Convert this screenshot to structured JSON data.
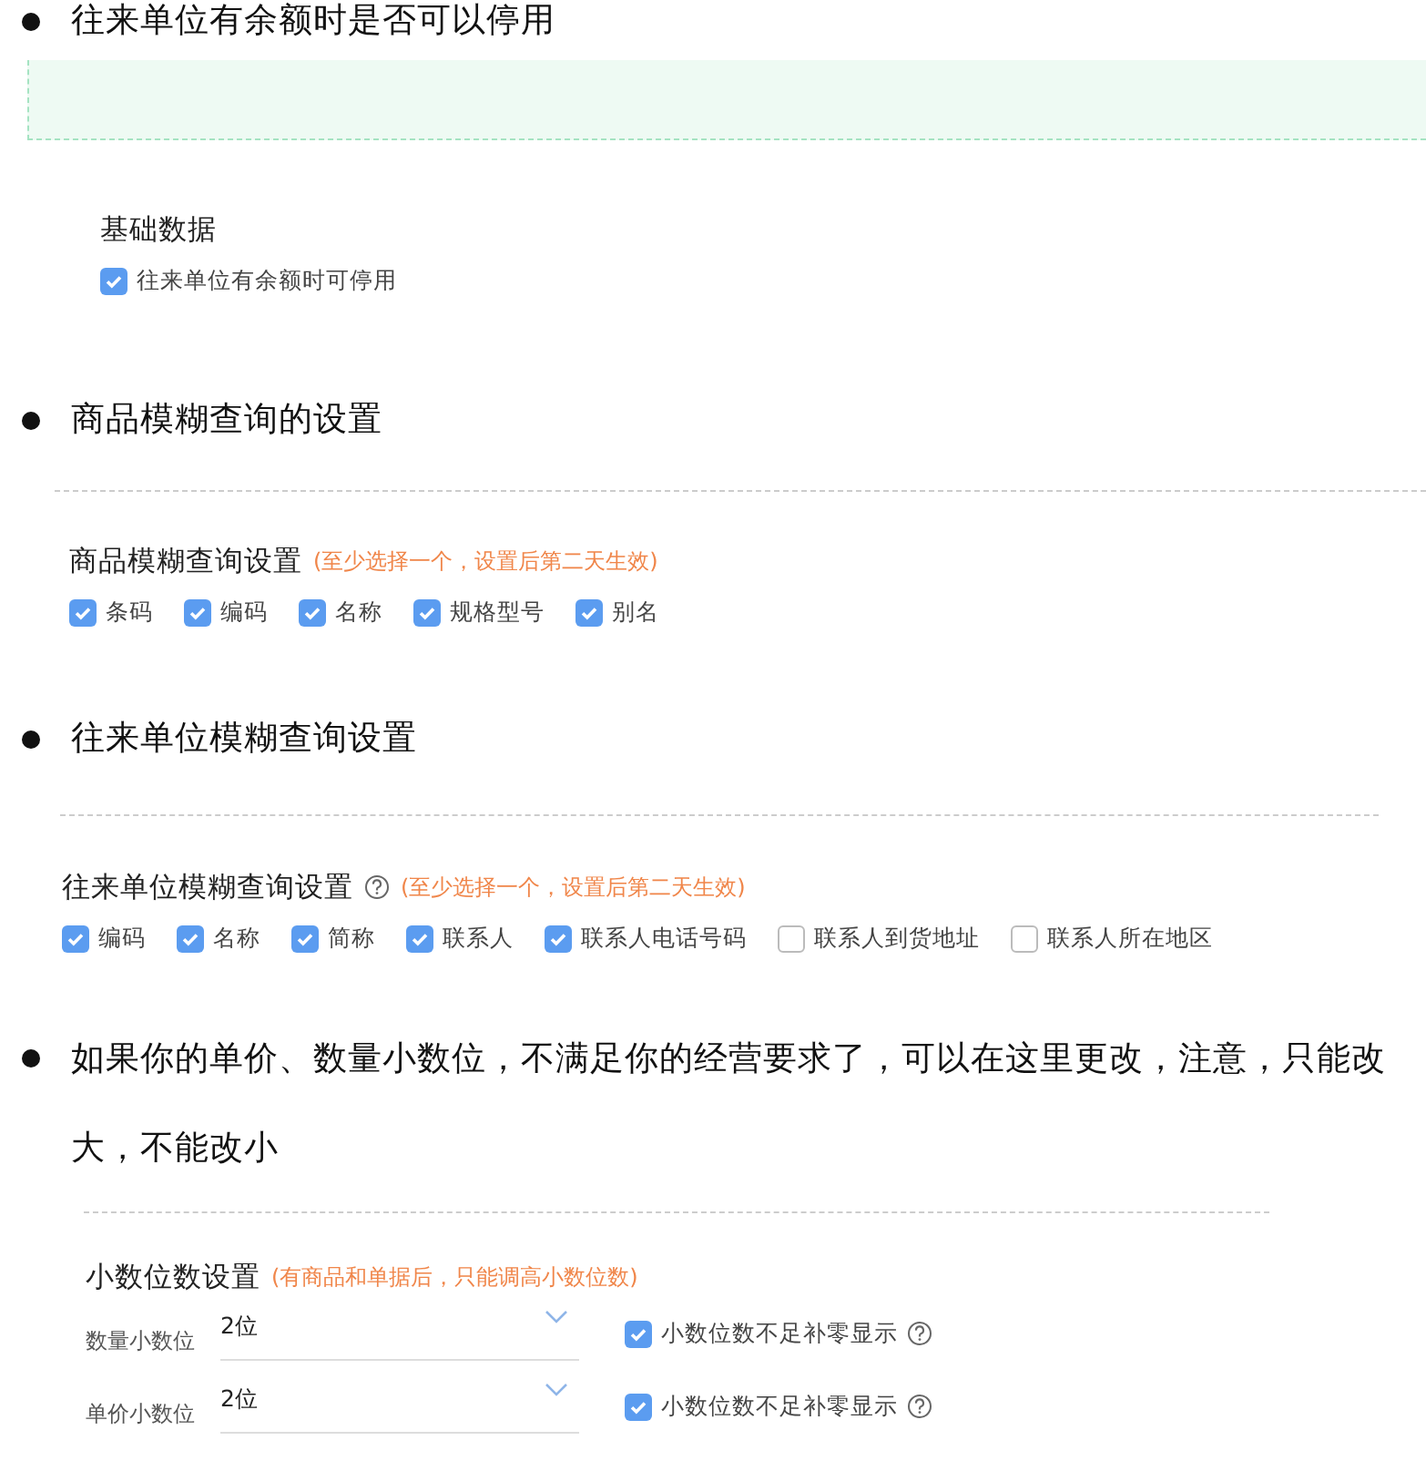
{
  "sections": [
    {
      "bullet": "往来单位有余额时是否可以停用",
      "panel": {
        "kind": "checks",
        "title": "基础数据",
        "checkboxes": [
          {
            "label": "往来单位有余额时可停用",
            "checked": true
          }
        ]
      }
    },
    {
      "bullet": "商品模糊查询的设置",
      "panel": {
        "kind": "checks",
        "title": "商品模糊查询设置",
        "hint": "(至少选择一个，设置后第二天生效)",
        "checkboxes": [
          {
            "label": "条码",
            "checked": true
          },
          {
            "label": "编码",
            "checked": true
          },
          {
            "label": "名称",
            "checked": true
          },
          {
            "label": "规格型号",
            "checked": true
          },
          {
            "label": "别名",
            "checked": true
          }
        ]
      }
    },
    {
      "bullet": "往来单位模糊查询设置",
      "panel": {
        "kind": "checks",
        "title": "往来单位模糊查询设置",
        "help": true,
        "hint": "(至少选择一个，设置后第二天生效)",
        "checkboxes": [
          {
            "label": "编码",
            "checked": true
          },
          {
            "label": "名称",
            "checked": true
          },
          {
            "label": "简称",
            "checked": true
          },
          {
            "label": "联系人",
            "checked": true
          },
          {
            "label": "联系人电话号码",
            "checked": true
          },
          {
            "label": "联系人到货地址",
            "checked": false
          },
          {
            "label": "联系人所在地区",
            "checked": false
          }
        ]
      }
    },
    {
      "bullet": "如果你的单价、数量小数位，不满足你的经营要求了，可以在这里更改，注意，只能改大，不能改小",
      "panel": {
        "kind": "decimals",
        "title": "小数位数设置",
        "hint": "(有商品和单据后，只能调高小数位数)",
        "rows": [
          {
            "label": "数量小数位",
            "value": "2位",
            "option": {
              "label": "小数位数不足补零显示",
              "checked": true,
              "help": true
            }
          },
          {
            "label": "单价小数位",
            "value": "2位",
            "option": {
              "label": "小数位数不足补零显示",
              "checked": true,
              "help": true
            }
          }
        ]
      }
    }
  ]
}
